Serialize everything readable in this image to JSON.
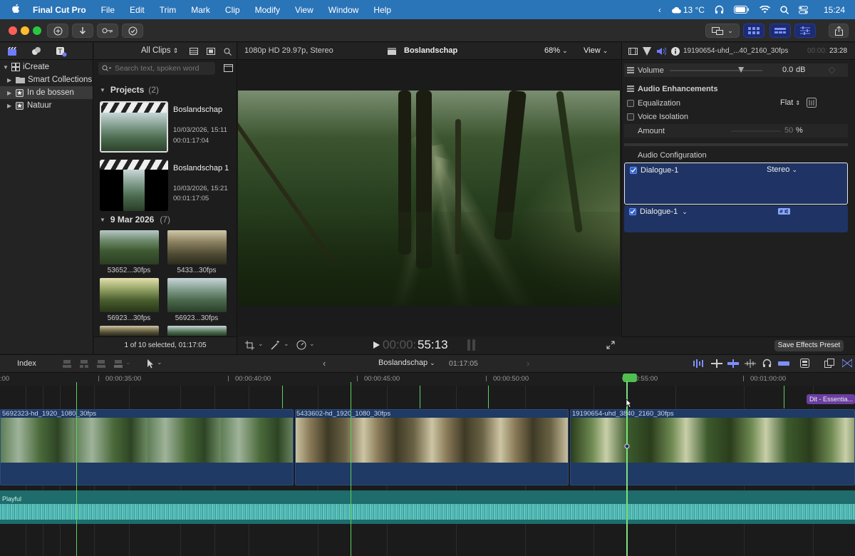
{
  "menubar": {
    "apple": "",
    "app": "Final Cut Pro",
    "items": [
      "File",
      "Edit",
      "Trim",
      "Mark",
      "Clip",
      "Modify",
      "View",
      "Window",
      "Help"
    ],
    "weather": "13 °C",
    "time": "15:24"
  },
  "sidebar": {
    "library": "iCreate",
    "items": [
      {
        "label": "Smart Collections"
      },
      {
        "label": "In de bossen"
      },
      {
        "label": "Natuur"
      }
    ]
  },
  "browser": {
    "filter": "All Clips",
    "search_placeholder": "Search text, spoken word",
    "projects_header": "Projects",
    "projects_count": "(2)",
    "projects": [
      {
        "name": "Boslandschap",
        "date": "10/03/2026, 15:11",
        "duration": "00:01:17:04"
      },
      {
        "name": "Boslandschap 1",
        "date": "10/03/2026, 15:21",
        "duration": "00:01:17:05"
      }
    ],
    "event_header": "9 Mar 2026",
    "event_count": "(7)",
    "clips": [
      "53652...30fps",
      "5433...30fps",
      "56923...30fps",
      "56923...30fps"
    ],
    "status": "1 of 10 selected, 01:17:05"
  },
  "viewer": {
    "format": "1080p HD 29.97p, Stereo",
    "project": "Boslandschap",
    "zoom": "68%",
    "view": "View",
    "timecode_dim": "00:00:",
    "timecode": "55:13"
  },
  "inspector": {
    "clip_name": "19190654-uhd_...40_2160_30fps",
    "duration_dim": "00:00:",
    "duration": "23:28",
    "volume_label": "Volume",
    "volume_value": "0.0",
    "volume_unit": "dB",
    "volume_level": 0.77,
    "enhancements": "Audio Enhancements",
    "equalization": "Equalization",
    "eq_value": "Flat",
    "voice_isolation": "Voice Isolation",
    "amount": "Amount",
    "amount_value": "50",
    "amount_unit": "%",
    "audio_config": "Audio Configuration",
    "config1_name": "Dialogue-1",
    "config1_value": "Stereo",
    "config2_name": "Dialogue-1",
    "save_preset": "Save Effects Preset"
  },
  "timeline": {
    "index": "Index",
    "project": "Boslandschap",
    "duration": "01:17:05",
    "ruler": [
      "00:00:35:00",
      "00:00:40:00",
      "00:00:45:00",
      "00:00:50:00",
      "00:00:55:00",
      "00:01:00:00"
    ],
    "ruler_left": ":00",
    "clips": [
      "5692323-hd_1920_1080_30fps",
      "5433602-hd_1920_1080_30fps",
      "19190654-uhd_3840_2160_30fps"
    ],
    "audio_name": "Playful",
    "title_clip": "Dit - Essentia..."
  },
  "colors": {
    "menubar": "#2a74b8",
    "accent_blue": "#2f5fd0",
    "clip_blue": "#1f3a64",
    "audio_teal": "#1e6c6c",
    "playhead": "#5fd05f"
  }
}
